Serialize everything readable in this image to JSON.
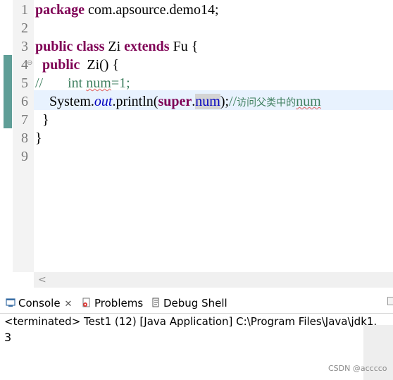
{
  "editor": {
    "line_numbers": [
      "1",
      "2",
      "3",
      "4",
      "5",
      "6",
      "7",
      "8",
      "9"
    ],
    "line1": {
      "kw": "package",
      "rest": " com.apsource.demo14;"
    },
    "line3": {
      "kw1": "public",
      "kw2": "class",
      "name": " Zi ",
      "kw3": "extends",
      "rest": " Fu {"
    },
    "line4": {
      "kw": "public",
      "rest": "  Zi() {"
    },
    "line5": {
      "slashes": "//",
      "ws": "       ",
      "int_kw": "int",
      "num": "num",
      "rest": "=1;"
    },
    "line6": {
      "sys": "System.",
      "out": "out",
      "println": ".println(",
      "super": "super",
      "dot": ".",
      "num": "num",
      "close": ");",
      "comment_slashes": "//",
      "comment_cn": "访问父类中的",
      "comment_num": "num"
    },
    "line7": {
      "text": "}"
    },
    "line8": {
      "text": "}"
    }
  },
  "tabs": {
    "console": "Console",
    "console_close": "✕",
    "problems": "Problems",
    "debug_shell": "Debug Shell"
  },
  "console": {
    "status": "<terminated> Test1 (12) [Java Application] C:\\Program Files\\Java\\jdk1.",
    "output": "3"
  },
  "scrollbar": {
    "left_arrow": "<"
  },
  "watermark": "CSDN @acccco",
  "colors": {
    "keyword": "#7f0055",
    "comment": "#3f7f5f",
    "field": "#0000c0",
    "change_bar": "#5f9e97"
  }
}
